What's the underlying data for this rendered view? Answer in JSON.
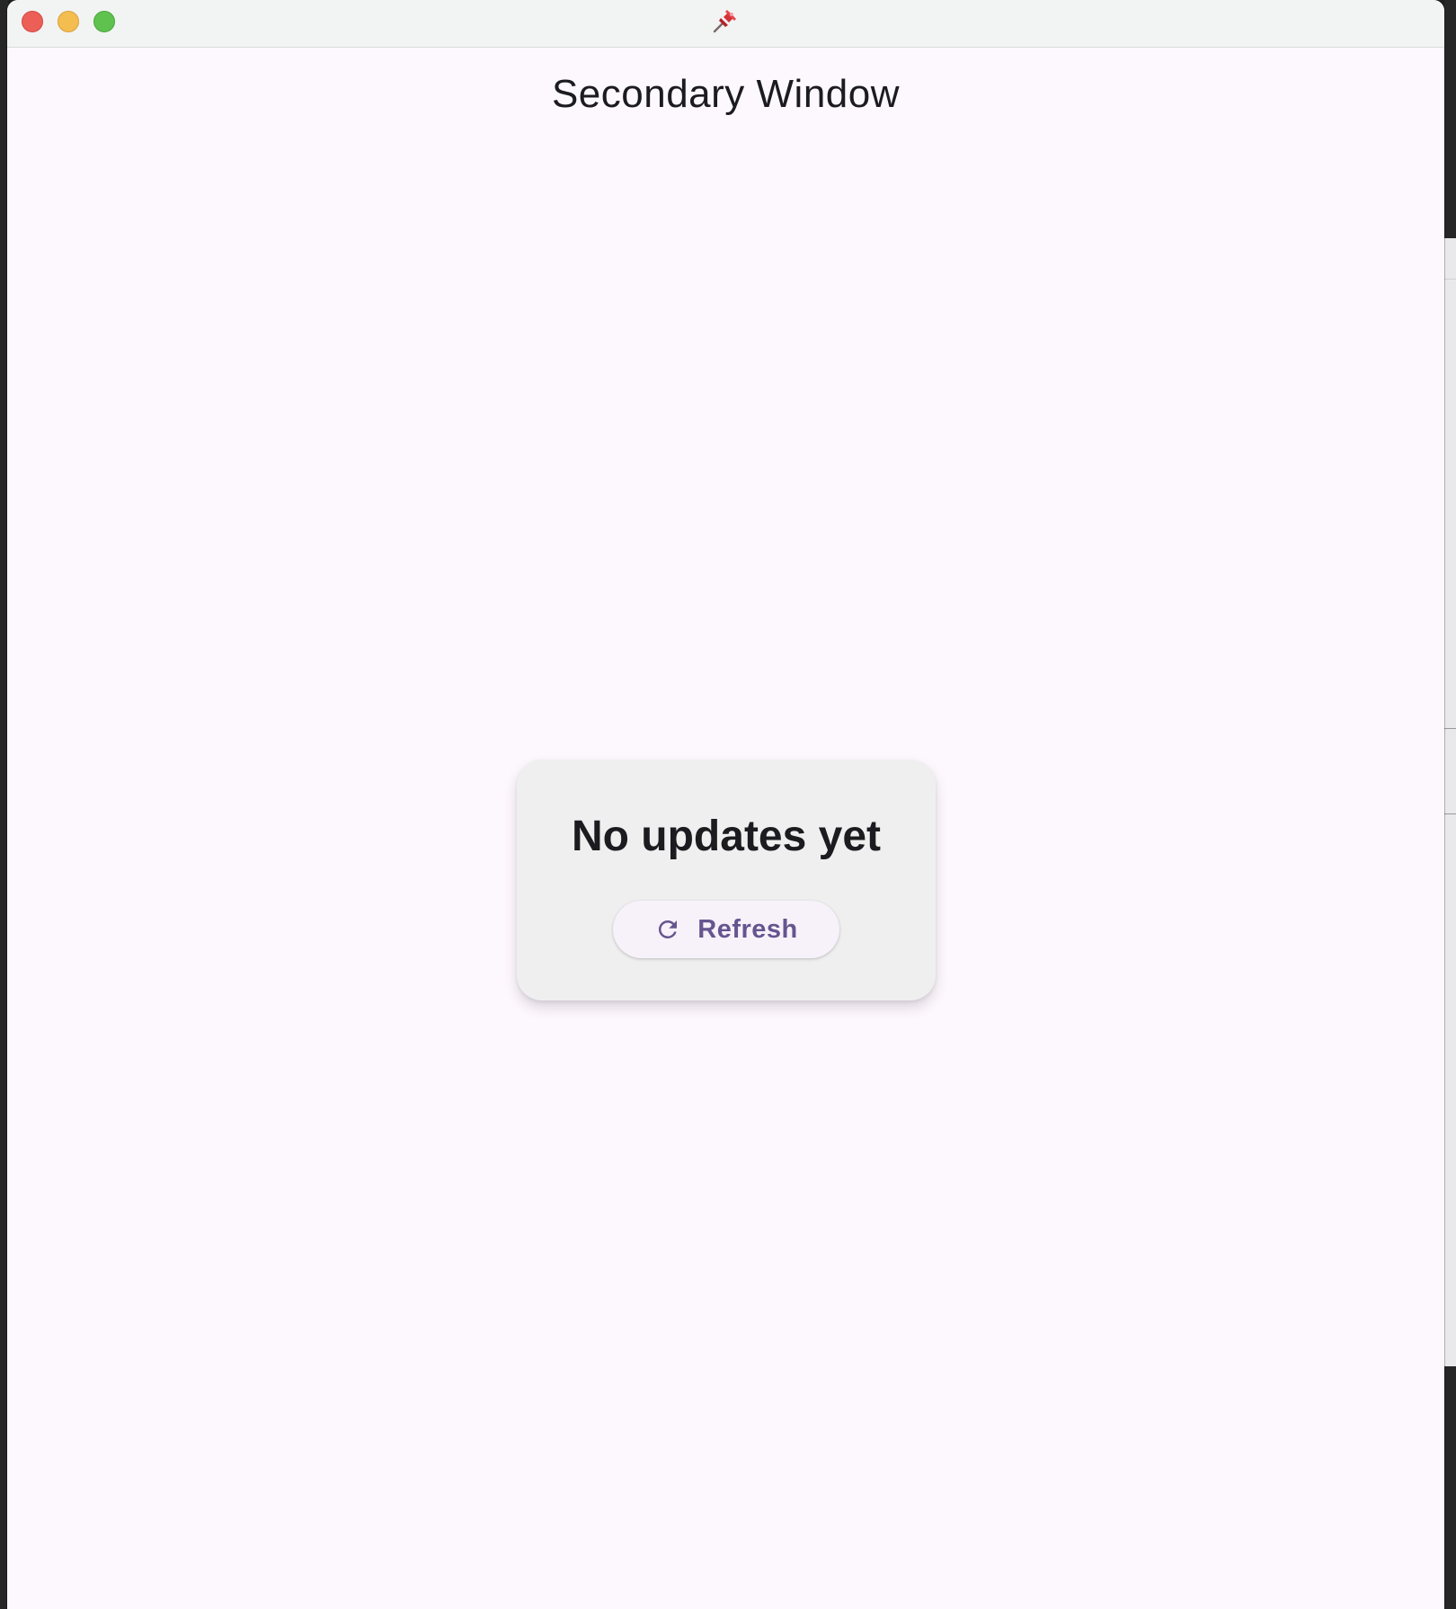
{
  "window": {
    "title_icon": "pushpin-icon",
    "heading": "Secondary Window"
  },
  "card": {
    "message": "No updates yet",
    "refresh_button": {
      "icon": "refresh-icon",
      "label": "Refresh"
    }
  },
  "colors": {
    "window_background": "#fdf8fd",
    "titlebar_background": "#f2f3f3",
    "card_background": "#efefef",
    "button_background": "#f7f2fa",
    "accent": "#65558f",
    "close": "#ec5f57",
    "minimize": "#f3bd4f",
    "maximize": "#5fc24f"
  }
}
